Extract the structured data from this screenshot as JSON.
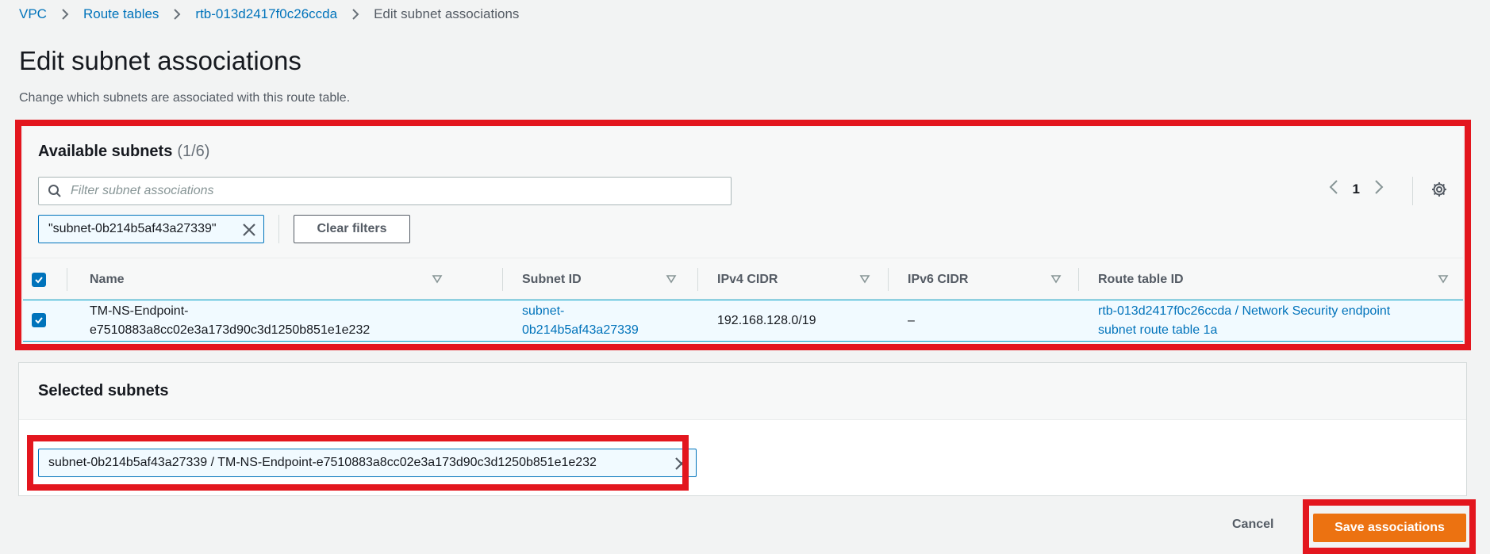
{
  "breadcrumb": {
    "items": [
      "VPC",
      "Route tables",
      "rtb-013d2417f0c26ccda"
    ],
    "current": "Edit subnet associations"
  },
  "page": {
    "title": "Edit subnet associations",
    "description": "Change which subnets are associated with this route table."
  },
  "available": {
    "title": "Available subnets",
    "count": "(1/6)",
    "search_placeholder": "Filter subnet associations",
    "filter_token": "\"subnet-0b214b5af43a27339\"",
    "clear_filters": "Clear filters",
    "page": "1",
    "columns": [
      "Name",
      "Subnet ID",
      "IPv4 CIDR",
      "IPv6 CIDR",
      "Route table ID"
    ],
    "rows": [
      {
        "name_line1": "TM-NS-Endpoint-",
        "name_line2": "e7510883a8cc02e3a173d90c3d1250b851e1e232",
        "subnet_line1": "subnet-",
        "subnet_line2": "0b214b5af43a27339",
        "ipv4": "192.168.128.0/19",
        "ipv6": "–",
        "rt_line1": "rtb-013d2417f0c26ccda / Network Security endpoint",
        "rt_line2": "subnet route table 1a"
      }
    ]
  },
  "selected": {
    "title": "Selected subnets",
    "token": "subnet-0b214b5af43a27339 / TM-NS-Endpoint-e7510883a8cc02e3a173d90c3d1250b851e1e232"
  },
  "actions": {
    "cancel": "Cancel",
    "save": "Save associations"
  },
  "colors": {
    "link": "#0073bb",
    "primary": "#ec7211",
    "highlight": "#e3161e"
  }
}
